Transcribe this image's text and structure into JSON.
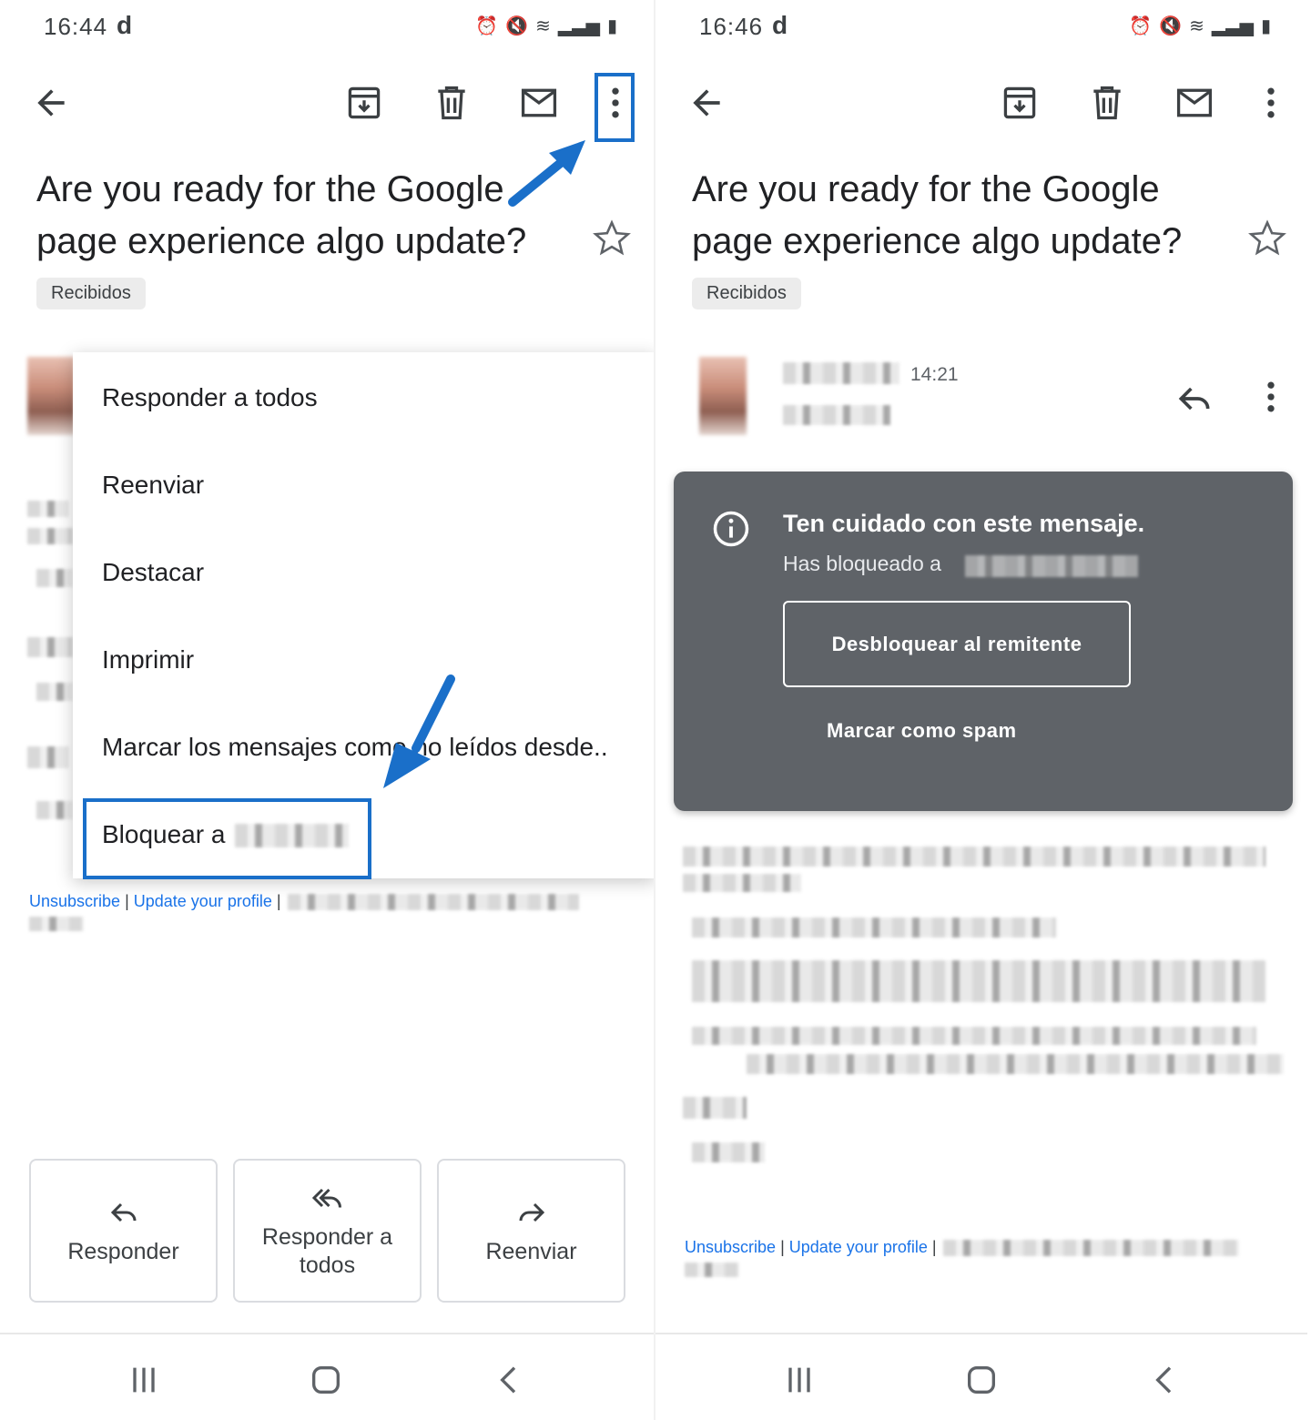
{
  "left": {
    "status": {
      "time": "16:44",
      "indicator": "d"
    },
    "subject": "Are you ready for the Google page experience algo update?",
    "label": "Recibidos",
    "menu": {
      "items": [
        "Responder a todos",
        "Reenviar",
        "Destacar",
        "Imprimir",
        "Marcar los mensajes como no leídos desde..",
        "Bloquear a"
      ]
    },
    "footer": {
      "unsubscribe": "Unsubscribe",
      "separator": "|",
      "update_profile": "Update your profile"
    },
    "actions": {
      "reply": "Responder",
      "reply_all": "Responder a todos",
      "forward": "Reenviar"
    }
  },
  "right": {
    "status": {
      "time": "16:46",
      "indicator": "d"
    },
    "subject": "Are you ready for the Google page experience algo update?",
    "label": "Recibidos",
    "sender": {
      "time": "14:21"
    },
    "warning": {
      "title": "Ten cuidado con este mensaje.",
      "subtitle": "Has bloqueado a",
      "unblock": "Desbloquear al remitente",
      "spam": "Marcar como spam"
    },
    "footer": {
      "unsubscribe": "Unsubscribe",
      "separator": "|",
      "update_profile": "Update your profile"
    }
  },
  "colors": {
    "highlight": "#1a6fc9",
    "warning_bg": "#5f6368",
    "link": "#1a73e8"
  },
  "icons": [
    "back-arrow-icon",
    "archive-icon",
    "trash-icon",
    "mail-icon",
    "more-vert-icon",
    "star-icon",
    "reply-icon",
    "reply-all-icon",
    "forward-icon",
    "info-icon",
    "recents-icon",
    "home-icon",
    "nav-back-icon"
  ]
}
